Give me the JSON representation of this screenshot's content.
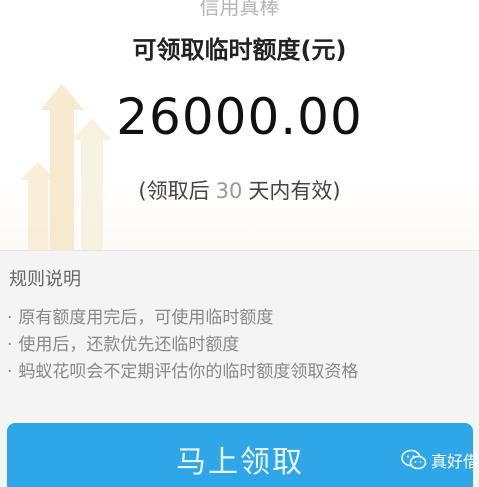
{
  "top_hint": "信用真棒",
  "quota": {
    "title": "可领取临时额度(元)",
    "amount": "26000.00",
    "validity_prefix": "(领取后",
    "validity_days": "30",
    "validity_suffix": "天内有效)"
  },
  "rules": {
    "title": "规则说明",
    "bullet": "·",
    "items": [
      "原有额度用完后，可使用临时额度",
      "使用后，还款优先还临时额度",
      "蚂蚁花呗会不定期评估你的临时额度领取资格"
    ]
  },
  "claim_button": {
    "label": "马上领取"
  },
  "watermark": {
    "text": "真好借",
    "icon": "wechat-icon"
  },
  "colors": {
    "button": "#2fa6e8",
    "rules_background": "#f4f4f4",
    "arrow_decoration": "#f7d98c"
  }
}
